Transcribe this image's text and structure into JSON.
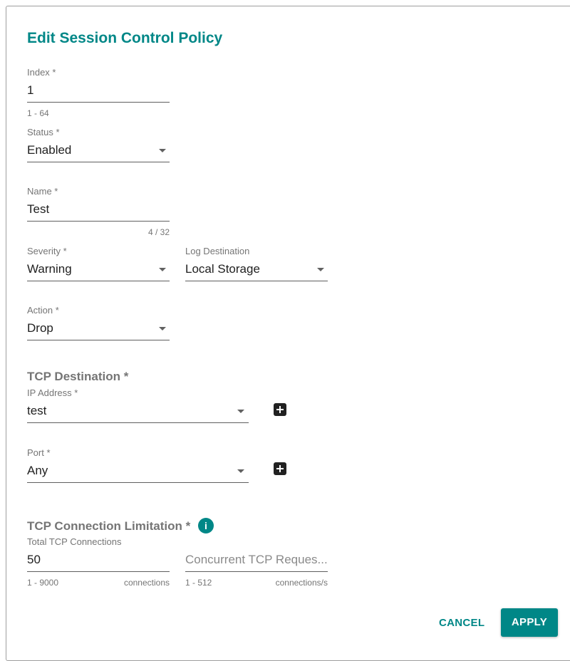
{
  "dialog": {
    "title": "Edit Session Control Policy",
    "fields": {
      "index": {
        "label": "Index *",
        "value": "1",
        "hint": "1 - 64"
      },
      "status": {
        "label": "Status *",
        "value": "Enabled"
      },
      "name": {
        "label": "Name *",
        "value": "Test",
        "counter": "4 / 32"
      },
      "severity": {
        "label": "Severity *",
        "value": "Warning"
      },
      "log_destination": {
        "label": "Log Destination",
        "value": "Local Storage"
      },
      "action": {
        "label": "Action *",
        "value": "Drop"
      }
    },
    "tcp_destination": {
      "heading": "TCP Destination *",
      "ip_address": {
        "label": "IP Address *",
        "value": "test"
      },
      "port": {
        "label": "Port *",
        "value": "Any"
      }
    },
    "tcp_limitation": {
      "heading": "TCP Connection Limitation *",
      "info_glyph": "i",
      "total": {
        "label": "Total TCP Connections",
        "value": "50",
        "hint": "1 - 9000",
        "unit": "connections"
      },
      "concurrent": {
        "placeholder": "Concurrent TCP Reques...",
        "hint": "1 - 512",
        "unit": "connections/s"
      }
    },
    "buttons": {
      "cancel": "CANCEL",
      "apply": "APPLY"
    },
    "colors": {
      "accent": "#008787",
      "text": "#212121",
      "muted": "#757575"
    },
    "icons": {
      "dropdown": "chevron-down-icon",
      "add": "plus-square-icon",
      "info": "info-icon"
    }
  }
}
